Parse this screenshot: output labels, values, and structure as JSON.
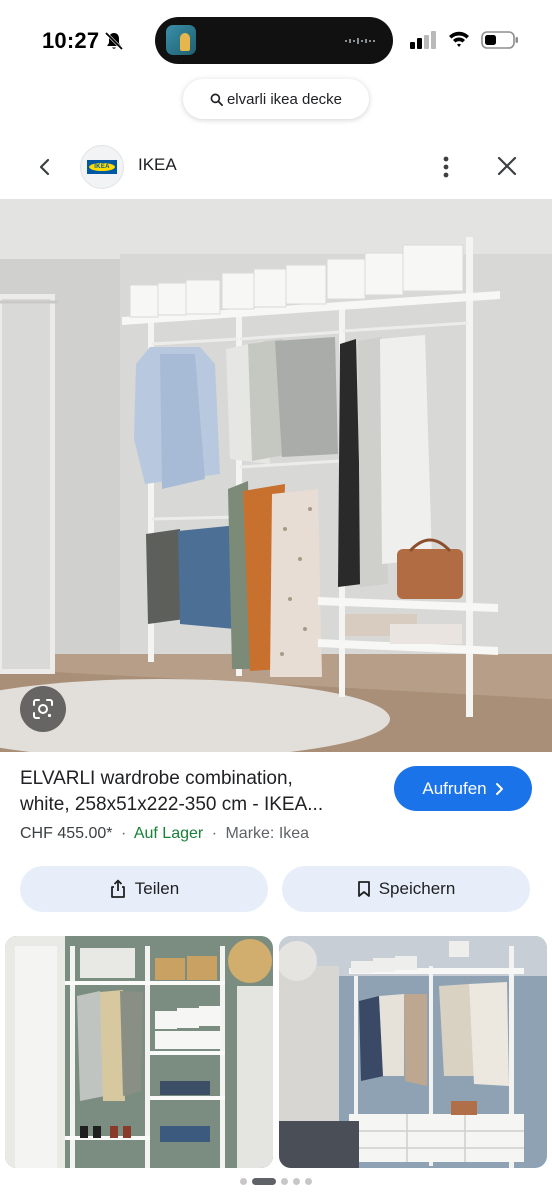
{
  "status_bar": {
    "time": "10:27"
  },
  "search": {
    "query": "elvarli ikea decke"
  },
  "header": {
    "site_name": "IKEA",
    "logo_text": "IKEA"
  },
  "product": {
    "title_line1": "ELVARLI wardrobe combination,",
    "title_line2": "white, 258x51x222-350 cm - IKEA...",
    "visit_label": "Aufrufen",
    "price": "CHF  455.00*",
    "stock": "Auf Lager",
    "brand": "Marke: Ikea",
    "separator": "·"
  },
  "actions": {
    "share_label": "Teilen",
    "save_label": "Speichern"
  },
  "pager": {
    "count": 5,
    "active_index": 1
  },
  "colors": {
    "accent": "#1a73e8",
    "in_stock": "#188038",
    "action_bg": "#e8eef9",
    "text_primary": "#202124",
    "text_secondary": "#5f6368"
  },
  "icons": {
    "status": [
      "bell-off-icon",
      "signal-icon",
      "wifi-icon",
      "battery-icon"
    ],
    "header": [
      "chevron-left-icon",
      "more-vert-icon",
      "close-icon"
    ],
    "search": "search-icon",
    "lens": "camera-lens-icon",
    "visit": "chevron-right-icon",
    "share": "share-icon",
    "save": "bookmark-icon"
  }
}
